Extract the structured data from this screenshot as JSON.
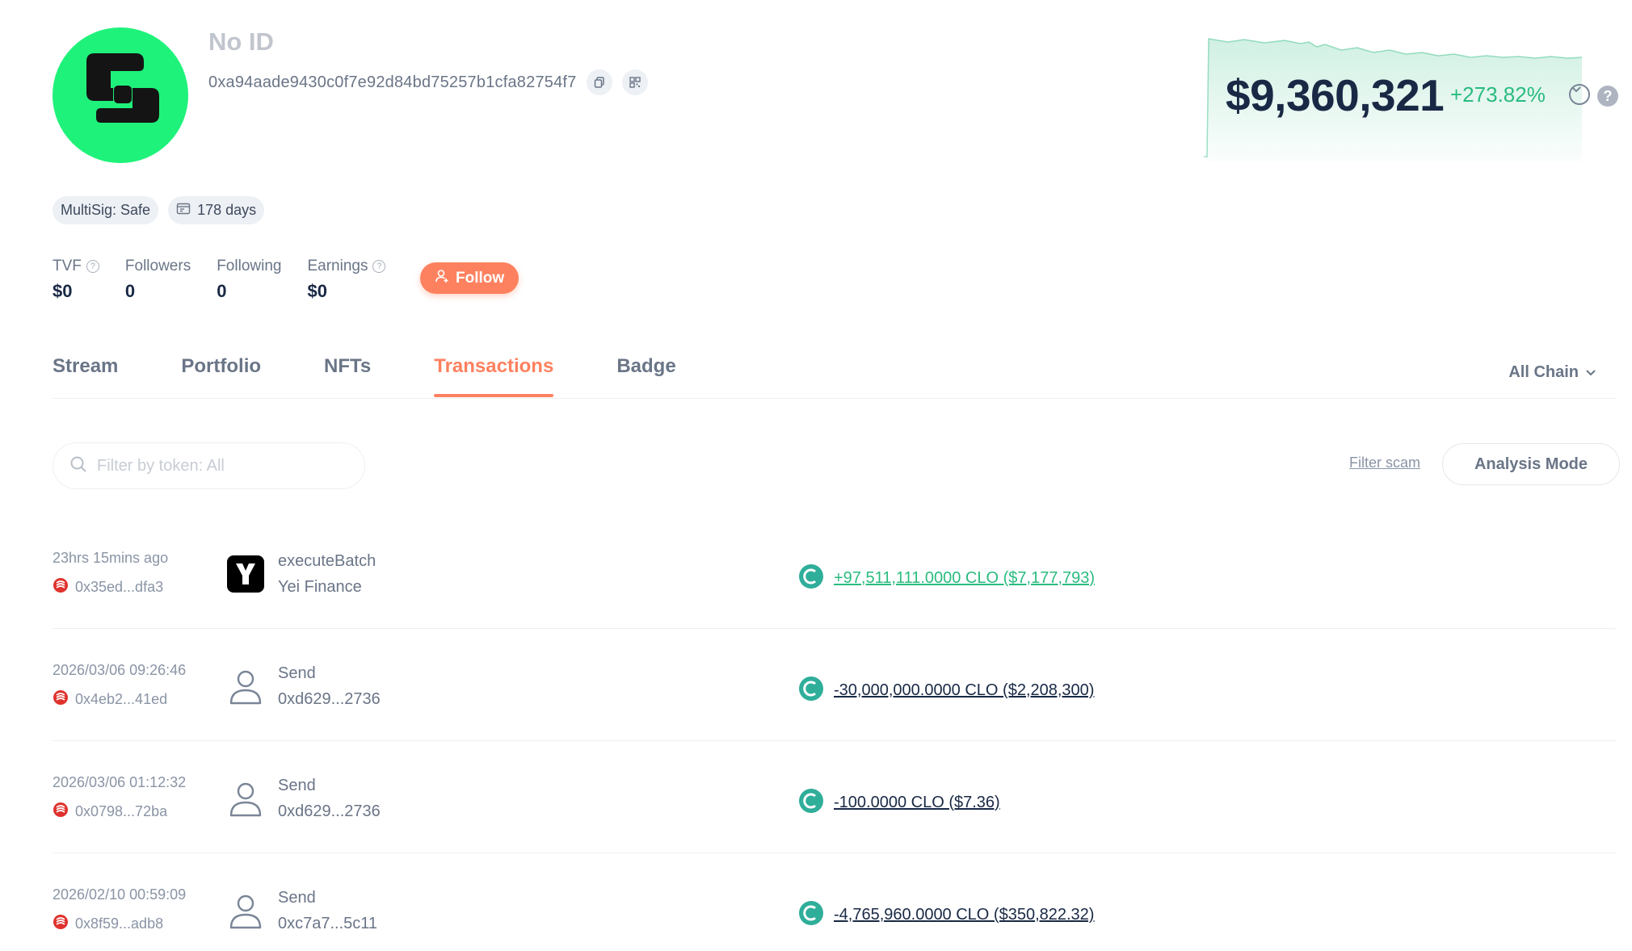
{
  "profile": {
    "name": "No ID",
    "address": "0xa94aade9430c0f7e92d84bd75257b1cfa82754f7",
    "avatar_color": "#1ff27a"
  },
  "tags": [
    {
      "label": "MultiSig: Safe"
    },
    {
      "label": "178 days",
      "icon": "calendar-icon"
    }
  ],
  "stats": [
    {
      "label": "TVF",
      "value": "$0",
      "help": true
    },
    {
      "label": "Followers",
      "value": "0",
      "help": false
    },
    {
      "label": "Following",
      "value": "0",
      "help": false
    },
    {
      "label": "Earnings",
      "value": "$0",
      "help": true
    }
  ],
  "follow_label": "Follow",
  "networth": {
    "value": "$9,360,321",
    "change": "+273.82%"
  },
  "tabs": [
    {
      "label": "Stream",
      "active": false
    },
    {
      "label": "Portfolio",
      "active": false
    },
    {
      "label": "NFTs",
      "active": false
    },
    {
      "label": "Transactions",
      "active": true
    },
    {
      "label": "Badge",
      "active": false
    }
  ],
  "chain_select": "All Chain",
  "search": {
    "placeholder": "Filter by token: All"
  },
  "filter_scam": "Filter scam",
  "analysis_mode": "Analysis Mode",
  "transactions": [
    {
      "time": "23hrs 15mins ago",
      "hash": "0x35ed...dfa3",
      "method": "executeBatch",
      "target": "Yei Finance",
      "icon": "yei-finance-icon",
      "amount": "+97,511,111.0000 CLO ($7,177,793)",
      "direction": "pos"
    },
    {
      "time": "2026/03/06 09:26:46",
      "hash": "0x4eb2...41ed",
      "method": "Send",
      "target": "0xd629...2736",
      "icon": "user-icon",
      "amount": "-30,000,000.0000 CLO ($2,208,300)",
      "direction": "neg"
    },
    {
      "time": "2026/03/06 01:12:32",
      "hash": "0x0798...72ba",
      "method": "Send",
      "target": "0xd629...2736",
      "icon": "user-icon",
      "amount": "-100.0000 CLO ($7.36)",
      "direction": "neg"
    },
    {
      "time": "2026/02/10 00:59:09",
      "hash": "0x8f59...adb8",
      "method": "Send",
      "target": "0xc7a7...5c11",
      "icon": "user-icon",
      "amount": "-4,765,960.0000 CLO ($350,822.32)",
      "direction": "neg"
    }
  ],
  "colors": {
    "accent": "#fe815f",
    "positive": "#2abb7f",
    "text": "#192945",
    "muted": "#6a7587"
  }
}
